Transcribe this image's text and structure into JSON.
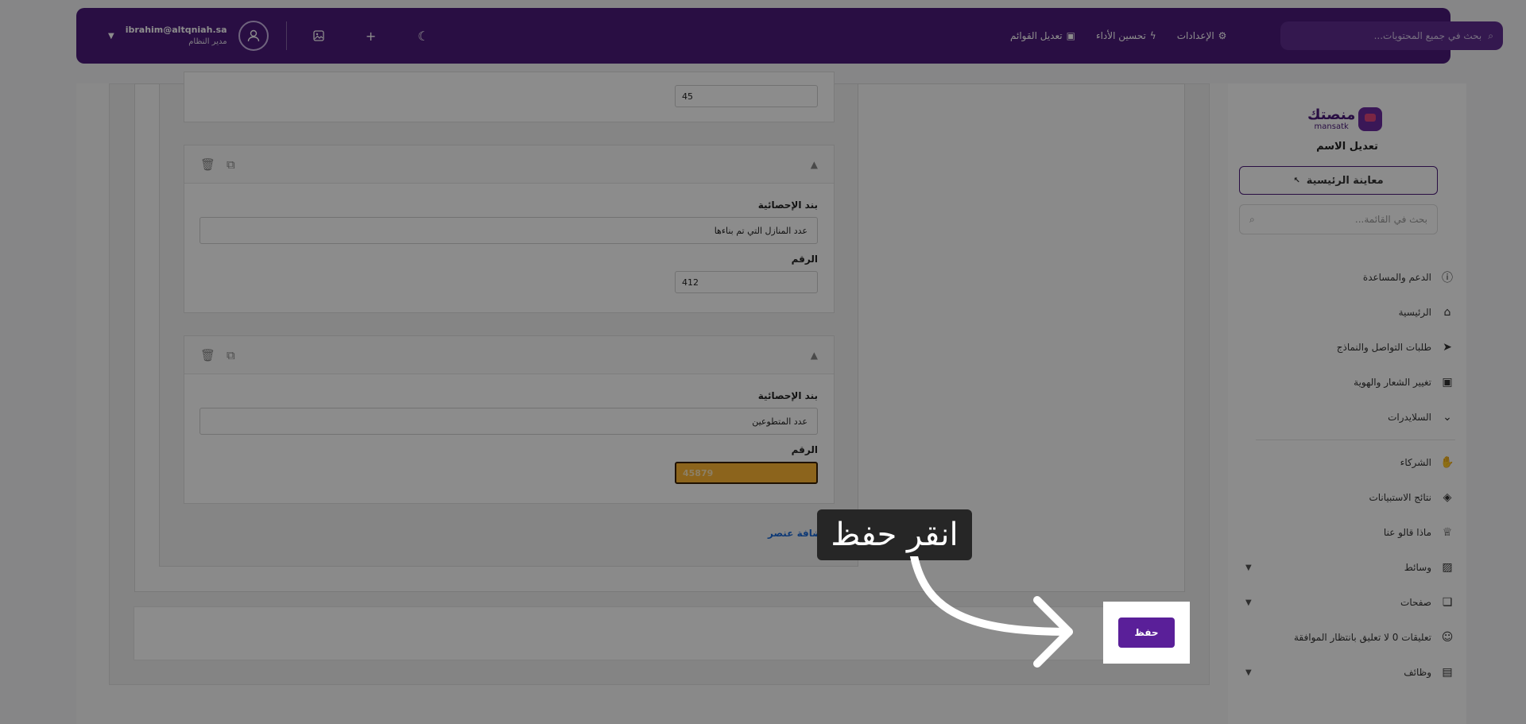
{
  "topbar": {
    "user_email": "ibrahim@altqniah.sa",
    "user_role": "مدير النظام",
    "links": [
      {
        "label": "الإعدادات",
        "icon": "gear-icon"
      },
      {
        "label": "تحسين الأداء",
        "icon": "lightning-icon"
      },
      {
        "label": "تعديل القوائم",
        "icon": "layout-icon"
      }
    ],
    "search_placeholder": "بحث في جميع المحتويات..."
  },
  "sidebar": {
    "logo_text": "منصتك",
    "logo_sub": "mansatk",
    "edit_name": "تعديل الاسم",
    "preview_label": "معاينة الرئيسية",
    "search_placeholder": "بحث في القائمة...",
    "items": [
      {
        "label": "الدعم والمساعدة",
        "icon": "help-circle-icon"
      },
      {
        "label": "الرئيسية",
        "icon": "home-icon"
      },
      {
        "label": "طلبات التواصل والنماذج",
        "icon": "send-icon"
      },
      {
        "label": "تغيير الشعار والهوية",
        "icon": "layout-icon"
      },
      {
        "label": "السلايدرات",
        "icon": "chevron-down-icon"
      },
      {
        "label": "الشركاء",
        "icon": "handshake-icon"
      },
      {
        "label": "نتائج الاستبيانات",
        "icon": "shapes-icon"
      },
      {
        "label": "ماذا قالو عنا",
        "icon": "crown-icon"
      },
      {
        "label": "وسائط",
        "icon": "image-icon"
      },
      {
        "label": "صفحات",
        "icon": "pages-icon"
      },
      {
        "label": "تعليقات 0 لا تعليق بانتظار الموافقة",
        "icon": "comment-icon"
      },
      {
        "label": "وظائف",
        "icon": "briefcase-icon"
      }
    ]
  },
  "cards": [
    {
      "number": "45"
    },
    {
      "stat_label": "بند الإحصائية",
      "stat_value": "عدد المنازل التي تم بناءها",
      "number_label": "الرقم",
      "number": "412"
    },
    {
      "stat_label": "بند الإحصائية",
      "stat_value": "عدد المتطوعين",
      "number_label": "الرقم",
      "number": "45879"
    }
  ],
  "add_item": "إضافة عنصر",
  "save_label": "حفظ",
  "tooltip": "انقر حفظ",
  "colors": {
    "brand": "#4b1a7a",
    "save": "#5a1f99",
    "highlight": "#ffb733"
  }
}
